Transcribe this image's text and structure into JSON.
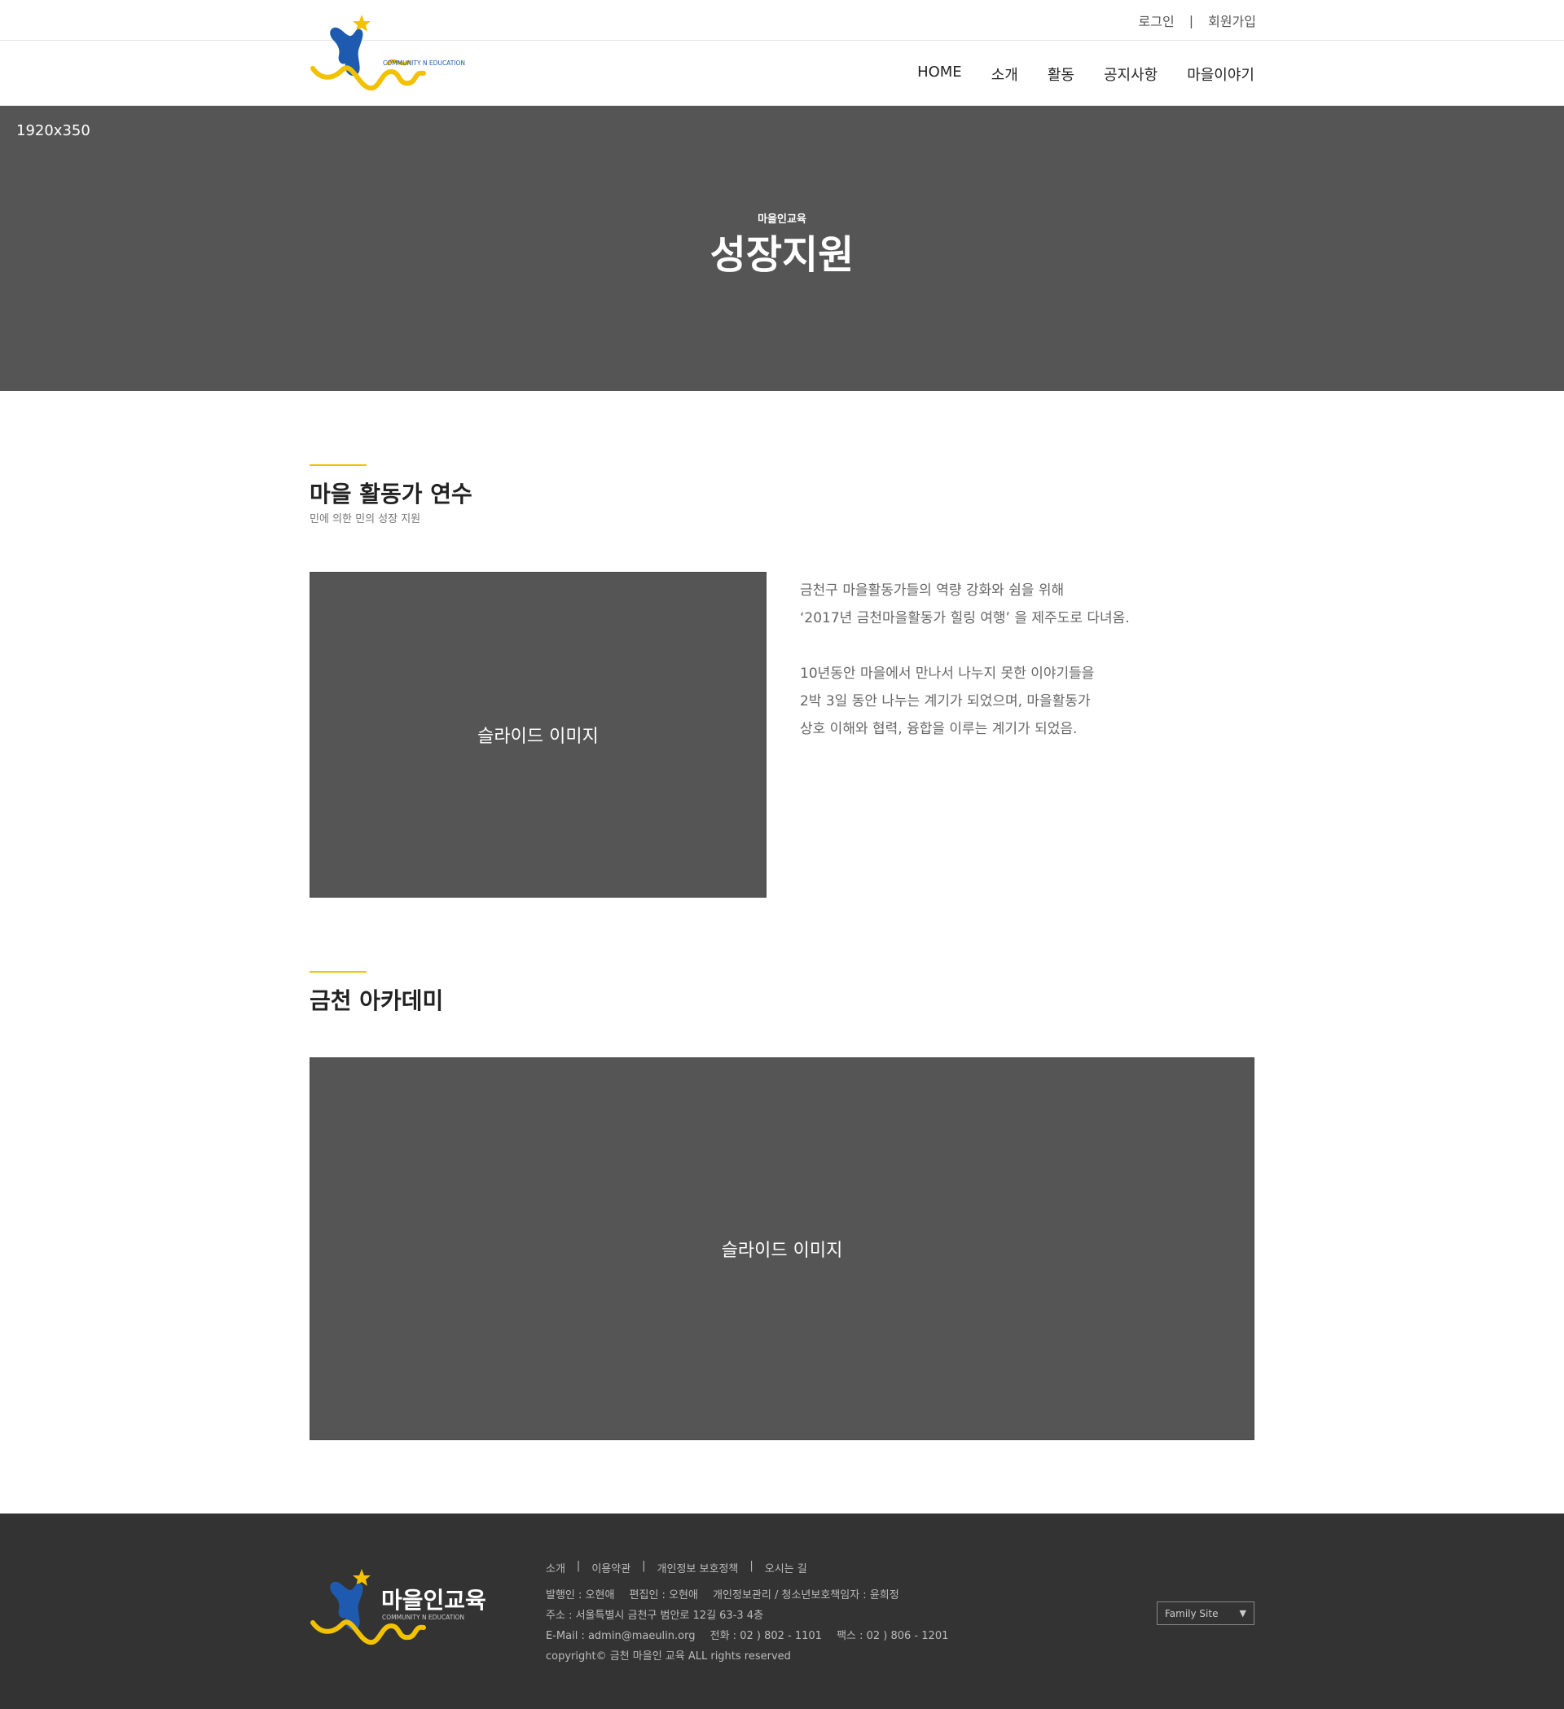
{
  "header": {
    "top_links": [
      "로그인",
      "|",
      "회원가입"
    ],
    "nav": [
      "HOME",
      "소개",
      "활동",
      "공지사항",
      "마을이야기"
    ],
    "logo_text": "COMMUNITY N EDUCATION"
  },
  "hero": {
    "size_label": "1920x350",
    "subtitle": "마을인교육",
    "title": "성장지원"
  },
  "section1": {
    "title": "마을 활동가 연수",
    "subtitle": "민에 의한 민의 성장 지원",
    "slide_label": "슬라이드 이미지",
    "paragraph1": [
      "금천구 마을활동가들의 역량 강화와 쉼을 위해",
      "‘2017년 금천마을활동가 힐링 여행’ 을 제주도로 다녀옴."
    ],
    "paragraph2": [
      "10년동안 마을에서 만나서 나누지 못한 이야기들을",
      "2박 3일 동안 나누는 계기가 되었으며, 마을활동가",
      "상호 이해와 협력, 융합을 이루는 계기가 되었음."
    ]
  },
  "section2": {
    "title": "금천 아카데미",
    "slide_label": "슬라이드 이미지"
  },
  "footer": {
    "logo_title": "마을인교육",
    "logo_sub": "COMMUNITY N EDUCATION",
    "links": [
      "소개",
      "|",
      "이용약관",
      "|",
      "개인정보 보호정책",
      "|",
      "오시는 길"
    ],
    "publisher": "발행인 : 오현애",
    "editor": "편집인 : 오현애",
    "privacy_manager": "개인정보관리 / 청소년보호책임자 : 윤희정",
    "address": "주소 : 서울특별시 금천구 범안로 12길 63-3 4층",
    "email": "E-Mail : admin@maeulin.org",
    "phone": "전화 : 02 ) 802 - 1101",
    "fax": "팩스 : 02 ) 806 - 1201",
    "copyright": "copyright© 금천 마을인 교육 ALL rights reserved",
    "family_site": "Family Site"
  },
  "colors": {
    "accent": "#f2c200",
    "logo_blue": "#1e5bb0",
    "hero_bg": "#555555",
    "footer_bg": "#333333"
  }
}
